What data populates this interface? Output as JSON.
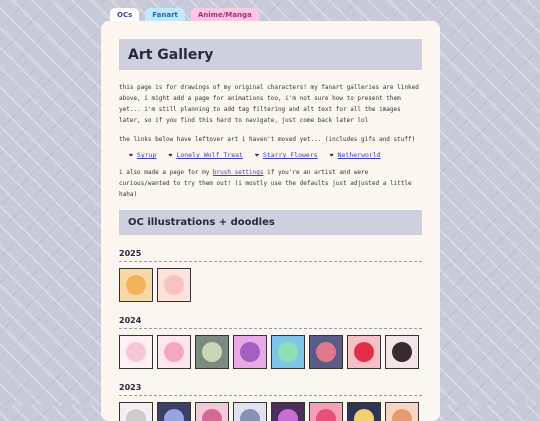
{
  "tabs": [
    "OCs",
    "Fanart",
    "Anime/Manga"
  ],
  "title": "Art Gallery",
  "intro": "this page is for drawings of my original characters! my fanart galleries are linked above, i might add a page for animations too, i'm not sure how to present them yet... i'm still planning to add tag filtering and alt text for all the images later, so if you find this hard to navigate, just come back later lol",
  "leftover": "the links below have leftover art i haven't moved yet... (includes gifs and stuff)",
  "links": [
    "Syrup",
    "Lonely Wolf Treat",
    "Starry Flowers",
    "Netherworld"
  ],
  "brush": {
    "before": "i also made a page for my ",
    "link": "brush settings",
    "after": " if you're an artist and were curious/wanted to try them out! (i mostly use the defaults just adjusted a little haha)"
  },
  "section_title": "OC illustrations + doodles",
  "years": [
    {
      "label": "2025",
      "thumbs": [
        {
          "icon": "oc-drawing-icon",
          "bg": "#f7d9a8",
          "face": "#f2b35c"
        },
        {
          "icon": "oc-drawing-icon",
          "bg": "#fbe3dc",
          "face": "#f6c3c0"
        }
      ]
    },
    {
      "label": "2024",
      "thumbs": [
        {
          "icon": "oc-drawing-icon",
          "bg": "#fff0f4",
          "face": "#f7c7d5"
        },
        {
          "icon": "oc-drawing-icon",
          "bg": "#fde6ef",
          "face": "#f4a7c2"
        },
        {
          "icon": "oc-drawing-icon",
          "bg": "#7d8a80",
          "face": "#c9d7b8"
        },
        {
          "icon": "oc-drawing-icon",
          "bg": "#e9a8e6",
          "face": "#a45ec4"
        },
        {
          "icon": "oc-drawing-icon",
          "bg": "#7cc6e8",
          "face": "#8fe0b7"
        },
        {
          "icon": "oc-drawing-icon",
          "bg": "#5a5c86",
          "face": "#e07a8a"
        },
        {
          "icon": "oc-drawing-icon",
          "bg": "#f5c1c6",
          "face": "#e03046"
        },
        {
          "icon": "oc-drawing-icon",
          "bg": "#f3e6e8",
          "face": "#3b2a30"
        }
      ]
    },
    {
      "label": "2023",
      "thumbs": [
        {
          "icon": "oc-drawing-icon",
          "bg": "#f4f0f0",
          "face": "#cccccc"
        },
        {
          "icon": "oc-drawing-icon",
          "bg": "#3b3f6a",
          "face": "#9aa3e0"
        },
        {
          "icon": "oc-drawing-icon",
          "bg": "#f2c9d6",
          "face": "#d46a92"
        },
        {
          "icon": "oc-drawing-icon",
          "bg": "#dfe2f0",
          "face": "#8a8fb8"
        },
        {
          "icon": "oc-drawing-icon",
          "bg": "#4b2d5e",
          "face": "#c46fd0"
        },
        {
          "icon": "oc-drawing-icon",
          "bg": "#f6a0b6",
          "face": "#e84f79"
        },
        {
          "icon": "oc-drawing-icon",
          "bg": "#2e3550",
          "face": "#f0d070"
        },
        {
          "icon": "oc-drawing-icon",
          "bg": "#f6d6c0",
          "face": "#e69a70"
        }
      ]
    }
  ]
}
